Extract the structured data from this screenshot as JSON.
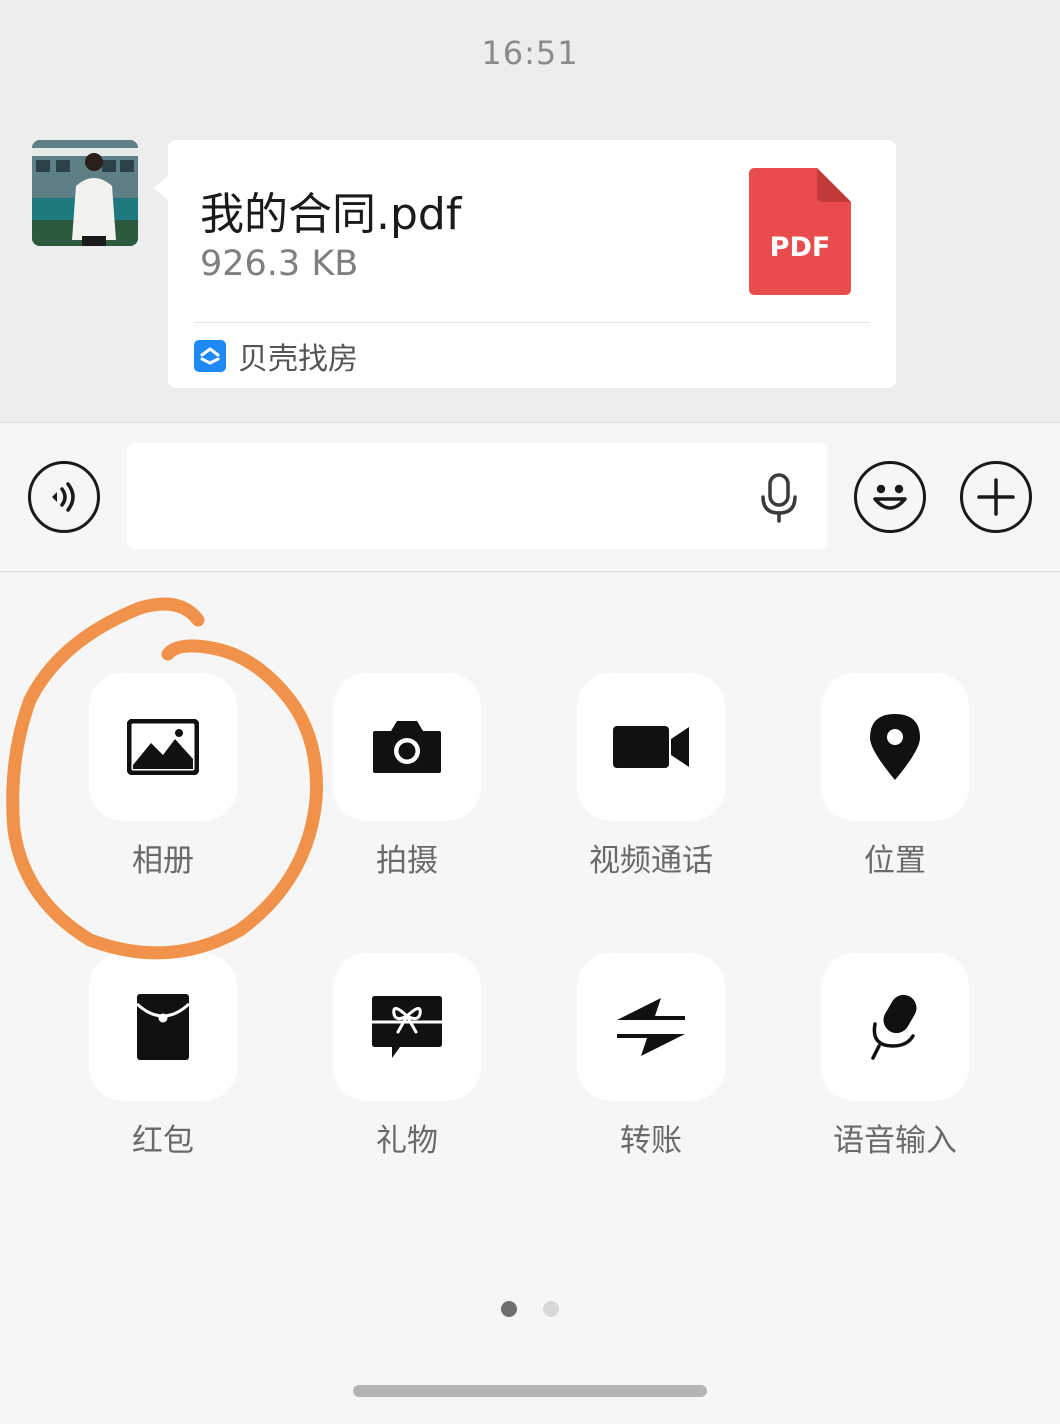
{
  "status": {
    "time": "16:51"
  },
  "message": {
    "file_name": "我的合同.pdf",
    "file_size": "926.3 KB",
    "file_badge": "PDF",
    "source_app": "贝壳找房",
    "accent": "#e84c4c",
    "source_color": "#1e88f5"
  },
  "input_bar": {
    "placeholder": "",
    "icons": [
      "voice-icon",
      "microphone-icon",
      "emoji-icon",
      "plus-icon"
    ]
  },
  "panel": {
    "items": [
      {
        "label": "相册",
        "icon": "photo-album-icon"
      },
      {
        "label": "拍摄",
        "icon": "camera-icon"
      },
      {
        "label": "视频通话",
        "icon": "video-call-icon"
      },
      {
        "label": "位置",
        "icon": "location-icon"
      },
      {
        "label": "红包",
        "icon": "red-packet-icon"
      },
      {
        "label": "礼物",
        "icon": "gift-icon"
      },
      {
        "label": "转账",
        "icon": "transfer-icon"
      },
      {
        "label": "语音输入",
        "icon": "voice-input-icon"
      }
    ],
    "page_count": 2,
    "current_page": 1
  },
  "annotation": {
    "shape": "hand-drawn circle around 相册",
    "color": "#f0924a"
  }
}
